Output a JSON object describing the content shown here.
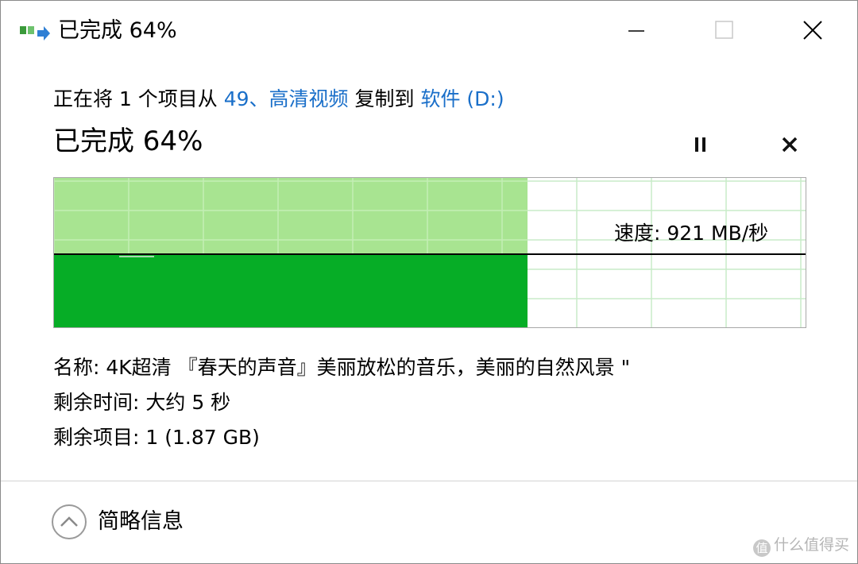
{
  "window": {
    "title": "已完成 64%",
    "colors": {
      "accent_link": "#1a6fc9",
      "progress_light": "#a8e491",
      "progress_dark": "#06ad26",
      "grid": "#c8ecc8"
    }
  },
  "transfer": {
    "prefix": "正在将 1 个项目从 ",
    "source": "49、高清视频",
    "middle": " 复制到 ",
    "destination": "软件 (D:)"
  },
  "progress": {
    "heading": "已完成 64%",
    "percent": 64,
    "speed_label": "速度: 921 MB/秒"
  },
  "details": {
    "name": "名称: 4K超清 『春天的声音』美丽放松的音乐，美丽的自然风景 \"",
    "time_remaining": "剩余时间: 大约 5 秒",
    "items_remaining": "剩余项目: 1 (1.87 GB)"
  },
  "footer": {
    "toggle_label": "简略信息"
  },
  "watermark": {
    "text": "什么值得买",
    "icon_glyph": "值"
  },
  "icons": {
    "app": "copy-transfer-icon",
    "minimize": "minimize-icon",
    "maximize": "maximize-icon",
    "close": "close-icon",
    "pause": "pause-icon",
    "cancel": "cancel-icon",
    "chevron": "chevron-up-icon"
  }
}
